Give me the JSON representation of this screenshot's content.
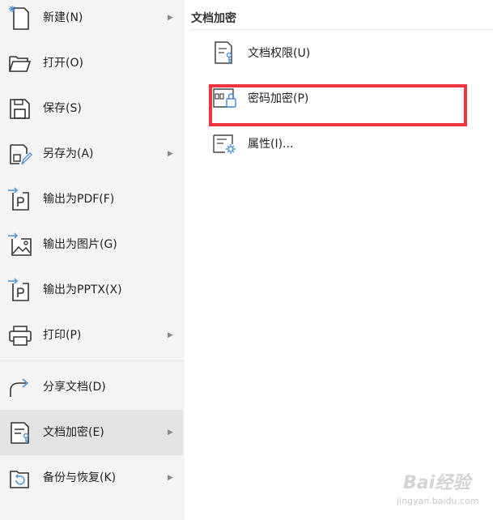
{
  "menu": {
    "items": [
      {
        "label": "新建(N)",
        "icon": "new-file-icon",
        "has_submenu": true
      },
      {
        "label": "打开(O)",
        "icon": "folder-open-icon",
        "has_submenu": false
      },
      {
        "label": "保存(S)",
        "icon": "save-icon",
        "has_submenu": false
      },
      {
        "label": "另存为(A)",
        "icon": "save-as-icon",
        "has_submenu": true
      },
      {
        "label": "输出为PDF(F)",
        "icon": "export-pdf-icon",
        "has_submenu": false
      },
      {
        "label": "输出为图片(G)",
        "icon": "export-image-icon",
        "has_submenu": false
      },
      {
        "label": "输出为PPTX(X)",
        "icon": "export-pptx-icon",
        "has_submenu": false
      },
      {
        "label": "打印(P)",
        "icon": "printer-icon",
        "has_submenu": true
      },
      {
        "label": "分享文档(D)",
        "icon": "share-icon",
        "has_submenu": false
      },
      {
        "label": "文档加密(E)",
        "icon": "document-encrypt-icon",
        "has_submenu": true,
        "active": true
      },
      {
        "label": "备份与恢复(K)",
        "icon": "backup-restore-icon",
        "has_submenu": true
      }
    ],
    "arrow_glyph": "▶"
  },
  "panel": {
    "title": "文档加密",
    "items": [
      {
        "label": "文档权限(U)",
        "icon": "document-permission-icon"
      },
      {
        "label": "密码加密(P)",
        "icon": "password-lock-icon",
        "highlighted": true
      },
      {
        "label": "属性(I)...",
        "icon": "properties-gear-icon"
      }
    ]
  },
  "watermark": {
    "main": "Bai经验",
    "sub": "jingyan.baidu.com"
  },
  "colors": {
    "highlight_border": "#ef3340",
    "icon_blue": "#4a90d9",
    "active_bg": "#e3e3e3",
    "menu_bg": "#f4f4f4"
  }
}
